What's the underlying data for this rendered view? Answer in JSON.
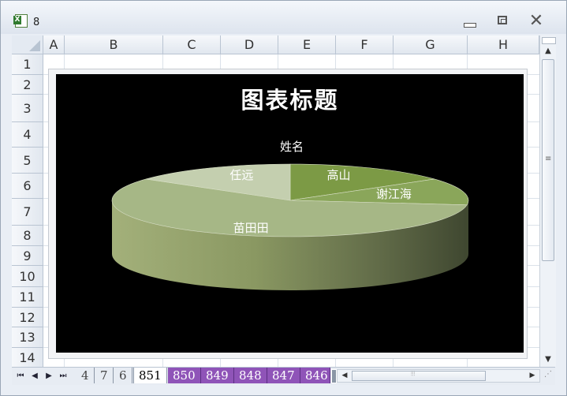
{
  "window": {
    "title": "8"
  },
  "columns": [
    "A",
    "B",
    "C",
    "D",
    "E",
    "F",
    "G",
    "H"
  ],
  "rows": [
    "1",
    "2",
    "3",
    "4",
    "5",
    "6",
    "7",
    "8",
    "9",
    "10",
    "11",
    "12",
    "13",
    "14"
  ],
  "chart": {
    "title": "图表标题"
  },
  "chart_data": {
    "type": "pie",
    "style": "3d-pie",
    "title": "图表标题",
    "series_label": "姓名",
    "categories": [
      "高山",
      "谢江海",
      "苗田田",
      "任远"
    ],
    "values": [
      15,
      12,
      58,
      15
    ],
    "colors": [
      "#7c9a45",
      "#8aa65a",
      "#a6b786",
      "#c4cfaf"
    ],
    "background": "#000000",
    "legend": "none"
  },
  "tabs": {
    "nav": [
      "first-sheet",
      "prev-sheet",
      "next-sheet",
      "last-sheet"
    ],
    "sheets": [
      "4",
      "7",
      "6",
      "851",
      "850",
      "849",
      "848",
      "847",
      "846"
    ],
    "active": "851"
  }
}
